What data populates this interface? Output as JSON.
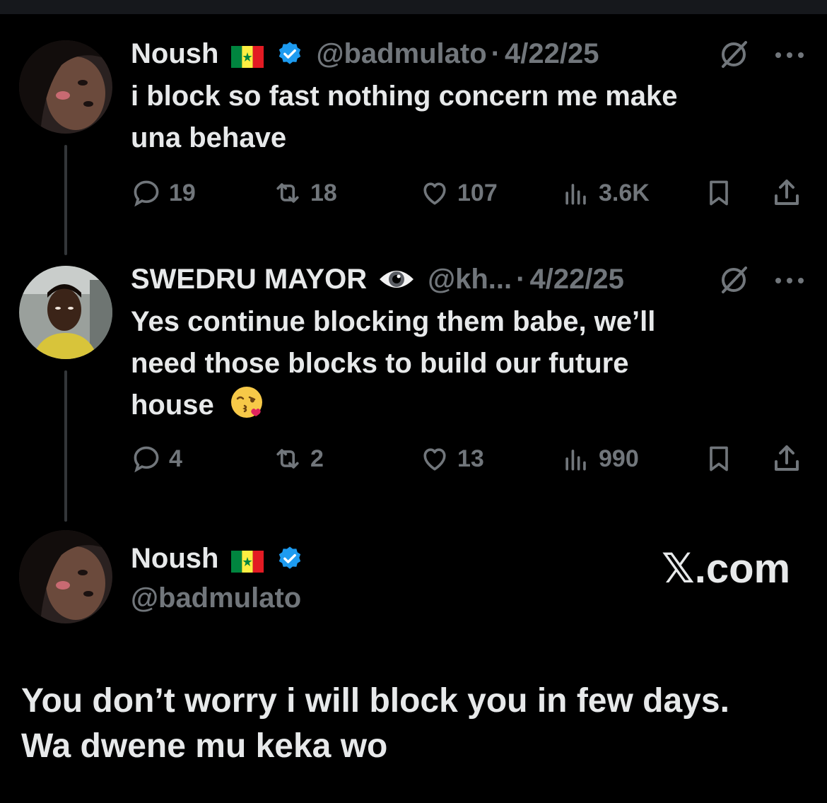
{
  "posts": [
    {
      "name": "Noush",
      "handle": "@badmulato",
      "date": "4/22/25",
      "text_lines": [
        "i block so fast nothing concern me make",
        "una behave"
      ],
      "replies": "19",
      "reposts": "18",
      "likes": "107",
      "views": "3.6K"
    },
    {
      "name": "SWEDRU MAYOR",
      "handle": "@kh...",
      "date": "4/22/25",
      "text_lines": [
        "Yes continue blocking them babe, we’ll",
        "need those blocks to build our future",
        "house"
      ],
      "replies": "4",
      "reposts": "2",
      "likes": "13",
      "views": "990"
    }
  ],
  "reply_author": {
    "name": "Noush",
    "handle": "@badmulato"
  },
  "brand": {
    "x_glyph": "𝕏",
    "domain": ".com"
  },
  "quote_lines": [
    "You don’t worry i will block you in few days.",
    "Wa dwene mu keka wo"
  ],
  "separator": "·",
  "colors": {
    "background": "#000000",
    "text": "#e7e9ea",
    "muted": "#71767b",
    "verified": "#1d9bf0"
  },
  "icons": [
    "reply-icon",
    "repost-icon",
    "like-icon",
    "views-icon",
    "bookmark-icon",
    "share-icon",
    "grok-icon",
    "more-icon",
    "verified-badge-icon",
    "senegal-flag-icon",
    "eye-emoji-icon",
    "kiss-emoji-icon"
  ]
}
